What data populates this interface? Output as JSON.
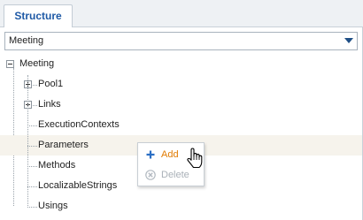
{
  "tabs": [
    {
      "label": "Structure",
      "active": true
    }
  ],
  "dropdown": {
    "value": "Meeting"
  },
  "tree": {
    "root": {
      "label": "Meeting",
      "expanded": true
    },
    "children": [
      {
        "label": "Pool1",
        "expandable": true
      },
      {
        "label": "Links",
        "expandable": true
      },
      {
        "label": "ExecutionContexts",
        "expandable": false
      },
      {
        "label": "Parameters",
        "expandable": false,
        "selected": true
      },
      {
        "label": "Methods",
        "expandable": false
      },
      {
        "label": "LocalizableStrings",
        "expandable": false
      },
      {
        "label": "Usings",
        "expandable": false
      }
    ]
  },
  "context_menu": {
    "items": [
      {
        "label": "Add",
        "icon": "plus-icon",
        "enabled": true
      },
      {
        "label": "Delete",
        "icon": "delete-circle-icon",
        "enabled": false
      }
    ]
  },
  "colors": {
    "accent": "#1f5aa6",
    "menu_add": "#e07a00",
    "disabled": "#a9b0b7",
    "selected_row": "#f6f3ec"
  }
}
